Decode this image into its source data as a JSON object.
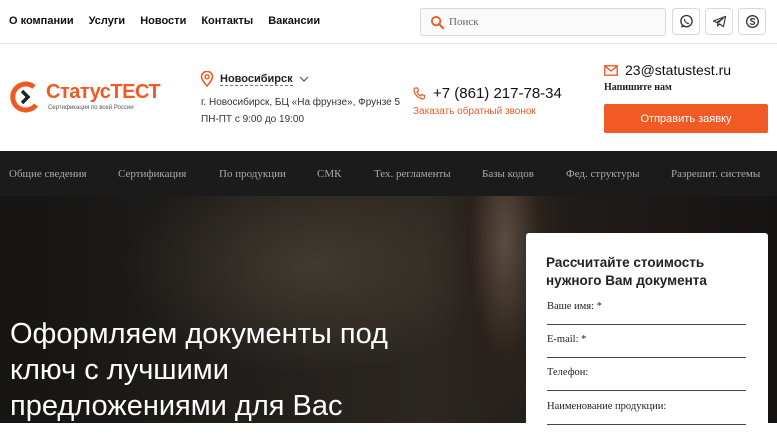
{
  "topnav": {
    "items": [
      {
        "label": "О компании"
      },
      {
        "label": "Услуги"
      },
      {
        "label": "Новости"
      },
      {
        "label": "Контакты"
      },
      {
        "label": "Вакансии"
      }
    ]
  },
  "search": {
    "placeholder": "Поиск"
  },
  "social": [
    {
      "icon": "whatsapp-icon"
    },
    {
      "icon": "telegram-icon"
    },
    {
      "icon": "skype-icon"
    }
  ],
  "logo": {
    "title": "СтатусТЕСТ",
    "subtitle": "Сертификация по всей России"
  },
  "location": {
    "city": "Новосибирск",
    "address": "г. Новосибирск, БЦ «На фрунзе», Фрунзе 5",
    "hours": "ПН-ПТ с 9:00 до 19:00"
  },
  "contact": {
    "phone": "+7 (861) 217-78-34",
    "callback": "Заказать обратный звонок",
    "email": "23@statustest.ru",
    "write": "Напишите нам",
    "send_button": "Отправить заявку"
  },
  "mainnav": {
    "items": [
      {
        "label": "Общие сведения"
      },
      {
        "label": "Сертификация"
      },
      {
        "label": "По продукции"
      },
      {
        "label": "СМК"
      },
      {
        "label": "Тех. регламенты"
      },
      {
        "label": "Базы кодов"
      },
      {
        "label": "Фед. структуры"
      },
      {
        "label": "Разрешит. системы"
      }
    ]
  },
  "hero": {
    "title": "Оформляем документы под ключ с лучшими предложениями для Вас"
  },
  "form": {
    "title": "Рассчитайте стоимость нужного Вам документа",
    "fields": [
      {
        "label": "Ваше имя: *"
      },
      {
        "label": "E-mail: *"
      },
      {
        "label": "Телефон:"
      },
      {
        "label": "Наименование продукции:"
      }
    ]
  },
  "colors": {
    "accent": "#f15a24",
    "nav_bg": "#1b1b1b",
    "nav_text": "#a9a9a9"
  }
}
